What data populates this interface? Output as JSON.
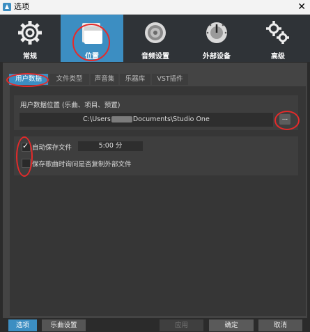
{
  "window": {
    "title": "选项",
    "close_glyph": "✕"
  },
  "toolbar": [
    {
      "id": "general",
      "label": "常规",
      "icon": "gear-icon",
      "active": false
    },
    {
      "id": "location",
      "label": "位置",
      "icon": "folder-icon",
      "active": true
    },
    {
      "id": "audio",
      "label": "音频设置",
      "icon": "speaker-icon",
      "active": false
    },
    {
      "id": "external",
      "label": "外部设备",
      "icon": "knob-icon",
      "active": false
    },
    {
      "id": "advanced",
      "label": "高级",
      "icon": "gears-icon",
      "active": false
    }
  ],
  "tabs": [
    {
      "label": "用户数据",
      "active": true
    },
    {
      "label": "文件类型",
      "active": false
    },
    {
      "label": "声音集",
      "active": false
    },
    {
      "label": "乐器库",
      "active": false
    },
    {
      "label": "VST插件",
      "active": false
    }
  ],
  "user_data": {
    "label": "用户数据位置 (乐曲、项目、预置)",
    "path_prefix": "C:\\Users",
    "path_suffix": "Documents\\Studio One",
    "browse_label": "..."
  },
  "autosave": {
    "label": "自动保存文件",
    "checked": true,
    "value": "5:00 分"
  },
  "copy_external": {
    "label": "保存歌曲时询问是否复制外部文件",
    "checked": false
  },
  "footer": {
    "options_label": "选项",
    "song_settings_label": "乐曲设置",
    "apply_label": "应用",
    "ok_label": "确定",
    "cancel_label": "取消"
  },
  "colors": {
    "accent": "#3c8ec2",
    "annotation": "#e52a2a",
    "background": "#2b2b2b"
  }
}
